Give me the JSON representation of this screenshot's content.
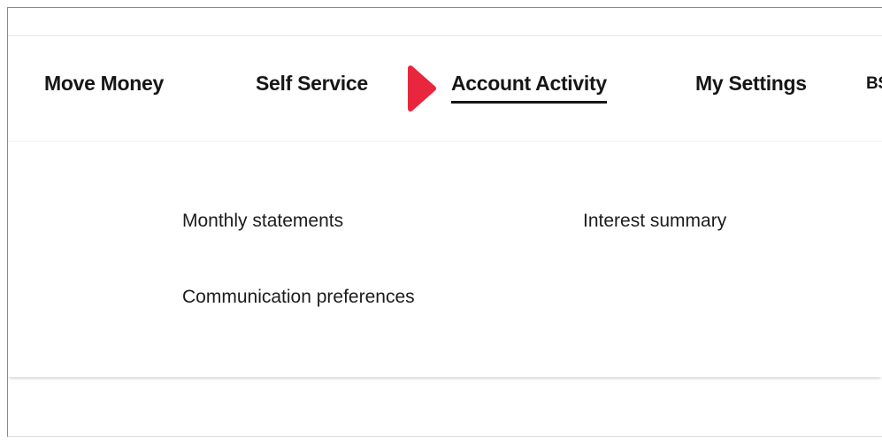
{
  "nav": {
    "items": [
      {
        "label": "Move Money"
      },
      {
        "label": "Self Service"
      },
      {
        "label": "Account Activity",
        "active": true
      },
      {
        "label": "My Settings"
      },
      {
        "label": "BS"
      }
    ],
    "pointer_icon": "play-triangle-icon",
    "pointer_color": "#e8263d"
  },
  "submenu": {
    "links": [
      {
        "label": "Monthly statements"
      },
      {
        "label": "Interest summary"
      },
      {
        "label": "Communication preferences"
      }
    ]
  }
}
